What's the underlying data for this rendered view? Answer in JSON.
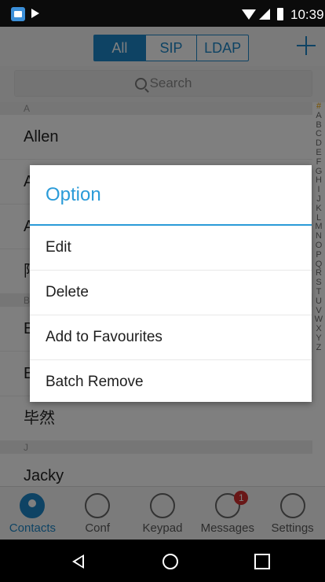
{
  "status_bar": {
    "time": "10:39"
  },
  "header": {
    "tabs": [
      {
        "label": "All",
        "active": true
      },
      {
        "label": "SIP",
        "active": false
      },
      {
        "label": "LDAP",
        "active": false
      }
    ]
  },
  "search": {
    "placeholder": "Search"
  },
  "contacts": {
    "section_a": "A",
    "row1": "Allen",
    "row2": "A",
    "row3": "A",
    "row4": "阿",
    "section_b": "B",
    "row5": "B",
    "row6": "B",
    "row7": "毕然",
    "section_j": "J",
    "row8": "Jacky"
  },
  "alphabet": [
    "#",
    "A",
    "B",
    "C",
    "D",
    "E",
    "F",
    "G",
    "H",
    "I",
    "J",
    "K",
    "L",
    "M",
    "N",
    "O",
    "P",
    "Q",
    "R",
    "S",
    "T",
    "U",
    "V",
    "W",
    "X",
    "Y",
    "Z"
  ],
  "dialog": {
    "title": "Option",
    "items": [
      "Edit",
      "Delete",
      "Add to Favourites",
      "Batch Remove"
    ]
  },
  "bottom_nav": [
    {
      "label": "Contacts",
      "icon": "contacts-icon",
      "active": true
    },
    {
      "label": "Conf",
      "icon": "conference-icon",
      "active": false
    },
    {
      "label": "Keypad",
      "icon": "keypad-icon",
      "active": false
    },
    {
      "label": "Messages",
      "icon": "messages-icon",
      "active": false,
      "badge": "1"
    },
    {
      "label": "Settings",
      "icon": "gear-icon",
      "active": false
    }
  ],
  "colors": {
    "accent": "#1d87c8",
    "dialog_title": "#2a9bd8",
    "badge": "#d32f2f"
  }
}
